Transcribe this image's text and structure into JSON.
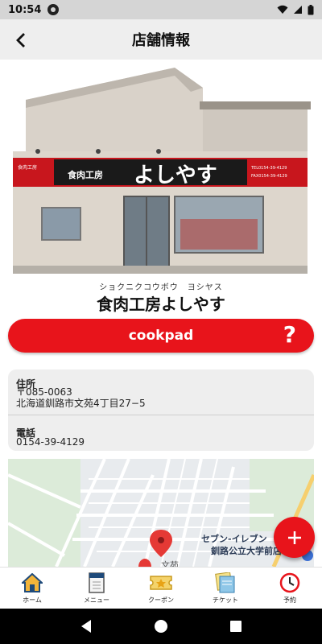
{
  "status_bar": {
    "time": "10:54"
  },
  "header": {
    "title": "店舗情報"
  },
  "store": {
    "name_kana": "ショクニクコウボウ　ヨシヤス",
    "name": "食肉工房よしやす",
    "photo": {
      "sign_main": "よしやす",
      "sign_logo": "食肉工房",
      "sign_left": "食肉工房",
      "sign_tel": "TEL0154-39-4129",
      "sign_fax": "FAX0154-39-4129"
    }
  },
  "cookpad_button": {
    "label": "cookpad",
    "help": "?"
  },
  "info": {
    "address_label": "住所",
    "postal_code": "〒085-0063",
    "address": "北海道釧路市文苑4丁目27−5",
    "phone_label": "電話",
    "phone": "0154-39-4129"
  },
  "map": {
    "poi_label": "セブン-イレブン\n釧路公立大学前店",
    "street_label": "文苑"
  },
  "fab": {
    "label": "+"
  },
  "bottom_nav": {
    "items": [
      {
        "label": "ホーム",
        "icon": "home-icon"
      },
      {
        "label": "メニュー",
        "icon": "menu-book-icon"
      },
      {
        "label": "クーポン",
        "icon": "coupon-icon"
      },
      {
        "label": "チケット",
        "icon": "ticket-icon"
      },
      {
        "label": "予約",
        "icon": "clock-icon"
      }
    ]
  },
  "colors": {
    "accent": "#e8141b",
    "header_bg": "#eeeeee",
    "card_bg": "#eeeeee"
  }
}
